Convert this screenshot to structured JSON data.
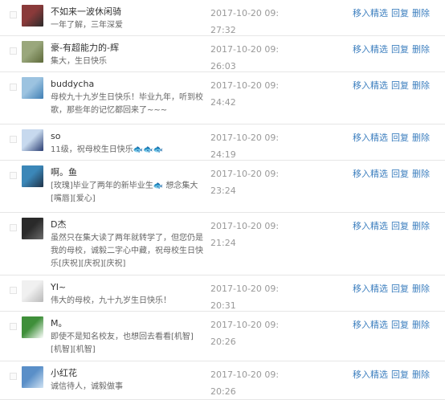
{
  "actions": {
    "feature": "移入精选",
    "reply": "回复",
    "delete": "删除"
  },
  "comments": [
    {
      "name": "不如来一波休闲骑",
      "text": "一年了解，三年深爱",
      "time": "2017-10-20 09:27:32",
      "avatar_icon": "cyclist-avatar-icon",
      "avatar_colors": [
        "#8a3a3a",
        "#2b2b2b"
      ]
    },
    {
      "name": "豪-有超能力的-辉",
      "text": "集大，生日快乐",
      "time": "2017-10-20 09:26:03",
      "avatar_icon": "landscape-avatar-icon",
      "avatar_colors": [
        "#9aa77c",
        "#5d6a3a"
      ]
    },
    {
      "name": "buddycha",
      "text": "母校九十九岁生日快乐！毕业九年，听到校歌，那些年的记忆都回来了~~~",
      "time": "2017-10-20 09:24:42",
      "avatar_icon": "sky-avatar-icon",
      "avatar_colors": [
        "#9cc3e0",
        "#3f7fb4"
      ]
    },
    {
      "name": "so",
      "text": "11级，祝母校生日快乐🐟🐟🐟",
      "time": "2017-10-20 09:24:19",
      "avatar_icon": "sea-avatar-icon",
      "avatar_colors": [
        "#c7d9ee",
        "#2a3d73"
      ]
    },
    {
      "name": "啊。鱼",
      "text": "[玫瑰]毕业了两年的新毕业生🐟 想念集大[嘴唇][爱心]",
      "time": "2017-10-20 09:23:24",
      "avatar_icon": "bridge-avatar-icon",
      "avatar_colors": [
        "#3b87b8",
        "#1f3248"
      ]
    },
    {
      "name": "D杰",
      "text": "虽然只在集大读了两年就转学了，但您仍是我的母校，诚毅二字心中藏，祝母校生日快乐[庆祝][庆祝][庆祝]",
      "time": "2017-10-20 09:21:24",
      "avatar_icon": "dark-avatar-icon",
      "avatar_colors": [
        "#2a2a2a",
        "#6b6b6b"
      ]
    },
    {
      "name": "YI~",
      "text": "伟大的母校，九十九岁生日快乐！",
      "time": "2017-10-20 09:20:31",
      "avatar_icon": "sketch-avatar-icon",
      "avatar_colors": [
        "#f0f0f0",
        "#b9b9b9"
      ]
    },
    {
      "name": "M。",
      "text": "即使不是知名校友，也想回去看看[机智][机智][机智]",
      "time": "2017-10-20 09:20:26",
      "avatar_icon": "frog-avatar-icon",
      "avatar_colors": [
        "#3f8f3a",
        "#ffffff"
      ]
    },
    {
      "name": "小红花",
      "text": "诚信待人，诚毅做事",
      "time": "2017-10-20 09:20:26",
      "avatar_icon": "ocean-avatar-icon",
      "avatar_colors": [
        "#5a8fc8",
        "#cfe2f3"
      ]
    }
  ]
}
